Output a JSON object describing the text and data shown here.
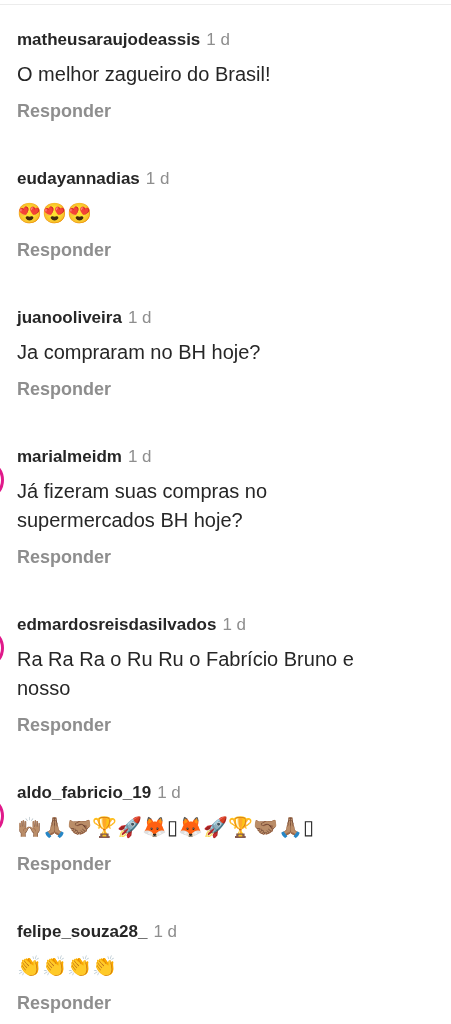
{
  "comments": [
    {
      "username": "matheusaraujodeassis",
      "time": "1 d",
      "text": "O melhor zagueiro do Brasil!",
      "reply": "Responder",
      "story_ring": false
    },
    {
      "username": "eudayannadias",
      "time": "1 d",
      "text": "😍😍😍",
      "reply": "Responder",
      "story_ring": false
    },
    {
      "username": "juanooliveira",
      "time": "1 d",
      "text": "Ja compraram no BH hoje?",
      "reply": "Responder",
      "story_ring": false
    },
    {
      "username": "marialmeidm",
      "time": "1 d",
      "text": "Já fizeram suas compras no supermercados BH hoje?",
      "reply": "Responder",
      "story_ring": true
    },
    {
      "username": "edmardosreisdasilvados",
      "time": "1 d",
      "text": "Ra Ra Ra o Ru Ru o Fabrício Bruno e nosso",
      "reply": "Responder",
      "story_ring": true
    },
    {
      "username": "aldo_fabricio_19",
      "time": "1 d",
      "text": "🙌🏽🙏🏽🤝🏽🏆🚀🦊▯🦊🚀🏆🤝🏽🙏🏽▯",
      "reply": "Responder",
      "story_ring": true
    },
    {
      "username": "felipe_souza28_",
      "time": "1 d",
      "text": "👏👏👏👏",
      "reply": "Responder",
      "story_ring": false
    }
  ]
}
